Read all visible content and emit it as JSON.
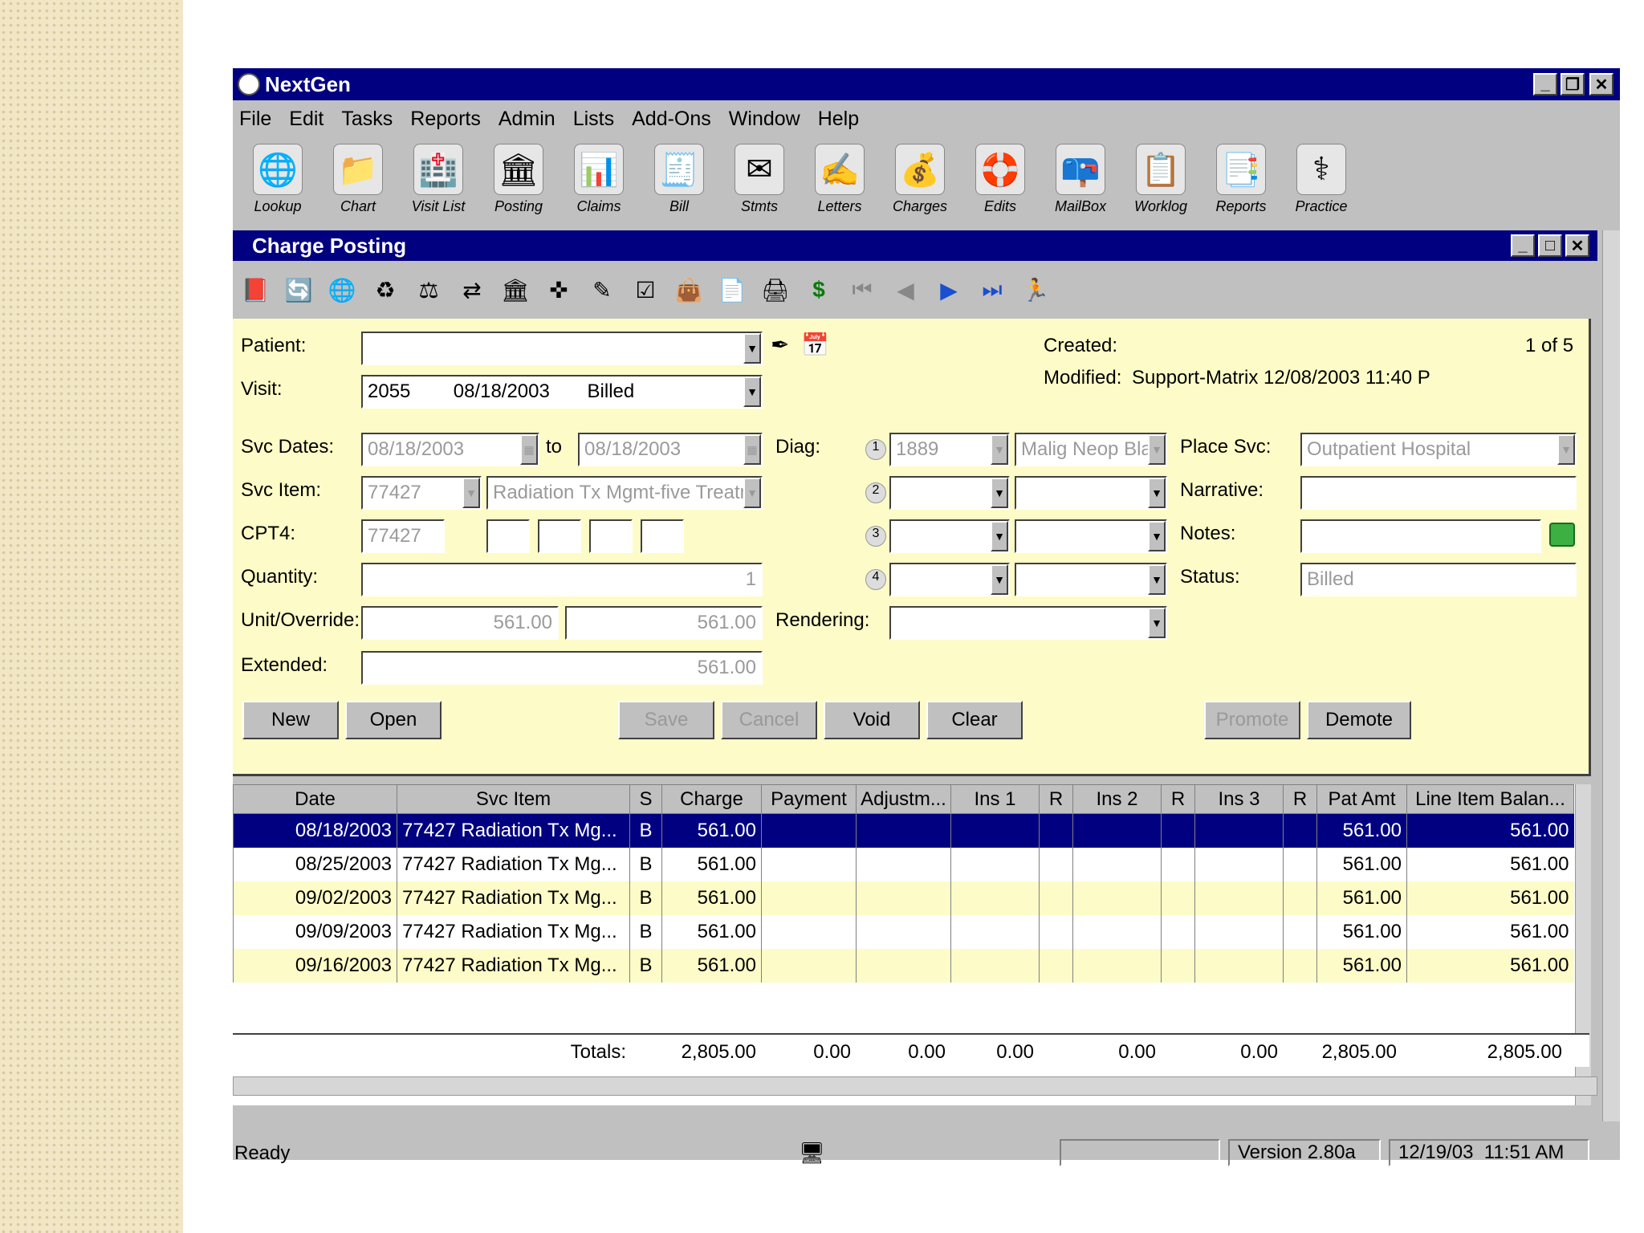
{
  "app": {
    "title": "NextGen"
  },
  "menu": [
    "File",
    "Edit",
    "Tasks",
    "Reports",
    "Admin",
    "Lists",
    "Add-Ons",
    "Window",
    "Help"
  ],
  "toolbar": [
    {
      "label": "Lookup",
      "icon": "globe-icon"
    },
    {
      "label": "Chart",
      "icon": "chart-folder-icon"
    },
    {
      "label": "Visit List",
      "icon": "visit-list-icon"
    },
    {
      "label": "Posting",
      "icon": "bank-icon"
    },
    {
      "label": "Claims",
      "icon": "claims-icon"
    },
    {
      "label": "Bill",
      "icon": "bill-icon"
    },
    {
      "label": "Stmts",
      "icon": "statements-icon"
    },
    {
      "label": "Letters",
      "icon": "letters-icon"
    },
    {
      "label": "Charges",
      "icon": "money-bag-icon"
    },
    {
      "label": "Edits",
      "icon": "life-ring-icon"
    },
    {
      "label": "MailBox",
      "icon": "mailbox-icon"
    },
    {
      "label": "Worklog",
      "icon": "worklog-icon"
    },
    {
      "label": "Reports",
      "icon": "reports-icon"
    },
    {
      "label": "Practice",
      "icon": "practice-icon"
    }
  ],
  "child": {
    "title": "Charge Posting"
  },
  "form": {
    "patient_label": "Patient:",
    "patient_value": "",
    "visit_label": "Visit:",
    "visit_value": "2055        08/18/2003       Billed",
    "created_label": "Created:",
    "modified_label": "Modified:",
    "modified_value": "Support-Matrix 12/08/2003 11:40 P",
    "record_count": "1 of 5",
    "svc_dates_label": "Svc Dates:",
    "svc_from": "08/18/2003",
    "to_label": "to",
    "svc_to": "08/18/2003",
    "svc_item_label": "Svc Item:",
    "svc_item_code": "77427",
    "svc_item_desc": "Radiation Tx Mgmt-five Treatm",
    "cpt4_label": "CPT4:",
    "cpt4_value": "77427",
    "quantity_label": "Quantity:",
    "quantity_value": "1",
    "unit_label": "Unit/Override:",
    "unit_value": "561.00",
    "override_value": "561.00",
    "extended_label": "Extended:",
    "extended_value": "561.00",
    "diag_label": "Diag:",
    "diag1_code": "1889",
    "diag1_desc": "Malig Neop Bla",
    "rendering_label": "Rendering:",
    "rendering_value": "",
    "place_label": "Place Svc:",
    "place_value": "Outpatient Hospital",
    "narrative_label": "Narrative:",
    "narrative_value": "",
    "notes_label": "Notes:",
    "notes_value": "",
    "status_label": "Status:",
    "status_value": "Billed"
  },
  "buttons": {
    "new": "New",
    "open": "Open",
    "save": "Save",
    "cancel": "Cancel",
    "void": "Void",
    "clear": "Clear",
    "promote": "Promote",
    "demote": "Demote"
  },
  "grid": {
    "columns": [
      "Date",
      "Svc Item",
      "S",
      "Charge",
      "Payment",
      "Adjustm...",
      "Ins 1",
      "R",
      "Ins 2",
      "R",
      "Ins 3",
      "R",
      "Pat Amt",
      "Line Item Balan..."
    ],
    "rows": [
      [
        "08/18/2003",
        "77427 Radiation Tx Mg...",
        "B",
        "561.00",
        "",
        "",
        "",
        "",
        "",
        "",
        "",
        "",
        "561.00",
        "561.00"
      ],
      [
        "08/25/2003",
        "77427 Radiation Tx Mg...",
        "B",
        "561.00",
        "",
        "",
        "",
        "",
        "",
        "",
        "",
        "",
        "561.00",
        "561.00"
      ],
      [
        "09/02/2003",
        "77427 Radiation Tx Mg...",
        "B",
        "561.00",
        "",
        "",
        "",
        "",
        "",
        "",
        "",
        "",
        "561.00",
        "561.00"
      ],
      [
        "09/09/2003",
        "77427 Radiation Tx Mg...",
        "B",
        "561.00",
        "",
        "",
        "",
        "",
        "",
        "",
        "",
        "",
        "561.00",
        "561.00"
      ],
      [
        "09/16/2003",
        "77427 Radiation Tx Mg...",
        "B",
        "561.00",
        "",
        "",
        "",
        "",
        "",
        "",
        "",
        "",
        "561.00",
        "561.00"
      ]
    ],
    "totals_label": "Totals:",
    "totals": {
      "charge": "2,805.00",
      "payment": "0.00",
      "adjust": "0.00",
      "ins1": "0.00",
      "ins2": "0.00",
      "ins3": "0.00",
      "pat_amt": "2,805.00",
      "balance": "2,805.00"
    }
  },
  "status": {
    "text": "Ready",
    "version": "Version 2.80a",
    "datetime": "12/19/03  11:51 AM"
  }
}
